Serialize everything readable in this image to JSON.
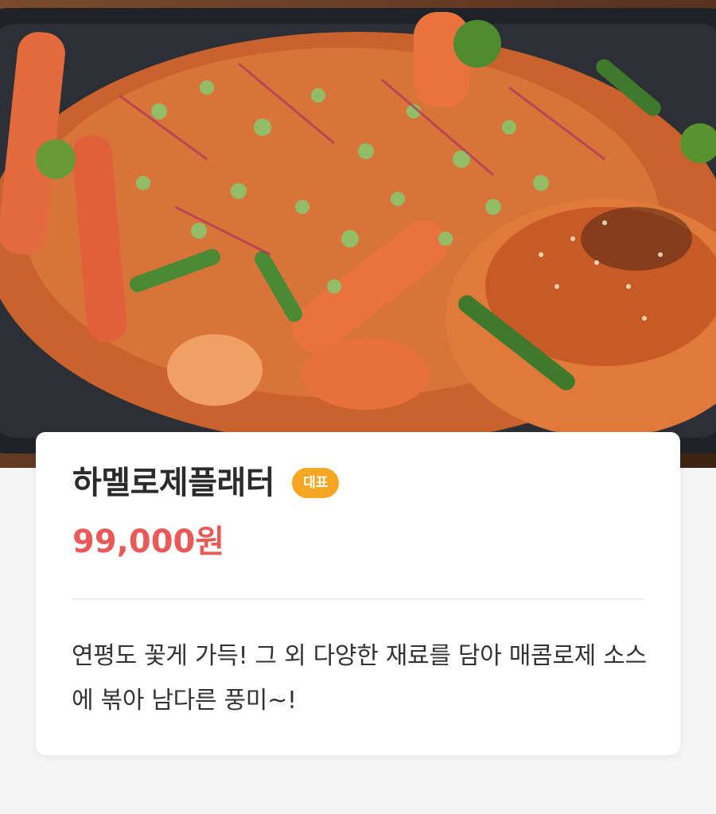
{
  "hero": {
    "image": "seafood-platter-photo"
  },
  "menu_item": {
    "name": "하멜로제플래터",
    "badge": "대표",
    "price": "99,000원",
    "description": "연평도 꽃게 가득! 그 외 다양한 재료를 담아 매콤로제 소스에 볶아 남다른 풍미~!"
  },
  "colors": {
    "badge_bg": "#f5a623",
    "price": "#e85a5a",
    "title": "#2b2b2b",
    "text": "#333333"
  }
}
